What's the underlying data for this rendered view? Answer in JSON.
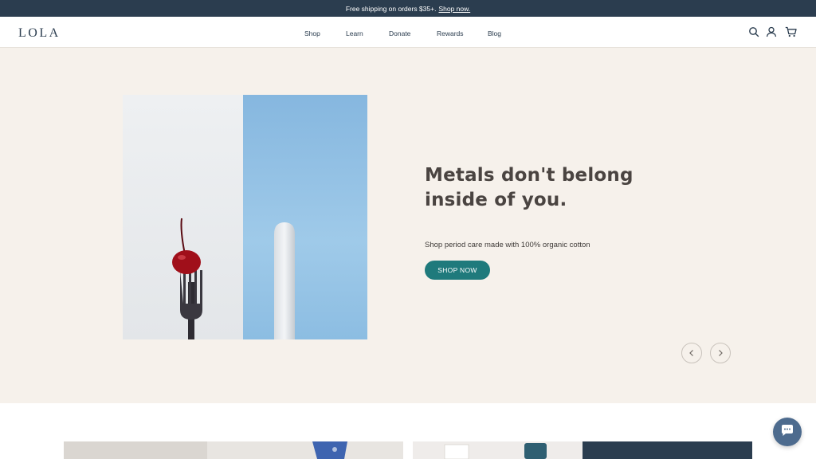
{
  "announcement": {
    "text": "Free shipping on orders $35+.",
    "link": "Shop now."
  },
  "header": {
    "logo": "LOLA",
    "nav": [
      {
        "label": "Shop"
      },
      {
        "label": "Learn"
      },
      {
        "label": "Donate"
      },
      {
        "label": "Rewards"
      },
      {
        "label": "Blog"
      }
    ],
    "icons": [
      "search-icon",
      "account-icon",
      "cart-icon"
    ]
  },
  "hero": {
    "title": "Metals don't belong inside of you.",
    "subtitle": "Shop period care made with 100% organic cotton",
    "cta": "SHOP NOW",
    "cta_color": "#1f7a7c",
    "background": "#f6f1eb"
  },
  "carousel": {
    "prev": "chevron-left-icon",
    "next": "chevron-right-icon"
  },
  "chat": {
    "icon": "chat-icon"
  },
  "colors": {
    "navy": "#2b3d4f",
    "teal": "#1f7a7c",
    "cream": "#f6f1eb"
  }
}
